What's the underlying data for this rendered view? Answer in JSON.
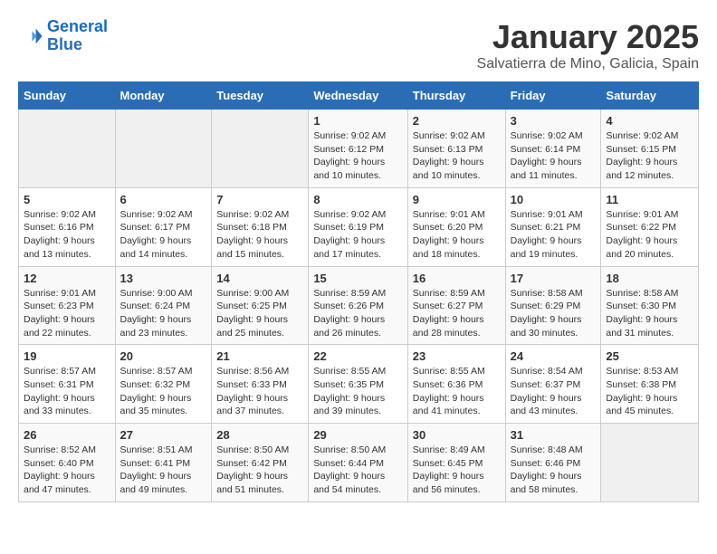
{
  "header": {
    "logo_line1": "General",
    "logo_line2": "Blue",
    "month": "January 2025",
    "location": "Salvatierra de Mino, Galicia, Spain"
  },
  "days_of_week": [
    "Sunday",
    "Monday",
    "Tuesday",
    "Wednesday",
    "Thursday",
    "Friday",
    "Saturday"
  ],
  "weeks": [
    [
      {
        "day": "",
        "content": ""
      },
      {
        "day": "",
        "content": ""
      },
      {
        "day": "",
        "content": ""
      },
      {
        "day": "1",
        "content": "Sunrise: 9:02 AM\nSunset: 6:12 PM\nDaylight: 9 hours and 10 minutes."
      },
      {
        "day": "2",
        "content": "Sunrise: 9:02 AM\nSunset: 6:13 PM\nDaylight: 9 hours and 10 minutes."
      },
      {
        "day": "3",
        "content": "Sunrise: 9:02 AM\nSunset: 6:14 PM\nDaylight: 9 hours and 11 minutes."
      },
      {
        "day": "4",
        "content": "Sunrise: 9:02 AM\nSunset: 6:15 PM\nDaylight: 9 hours and 12 minutes."
      }
    ],
    [
      {
        "day": "5",
        "content": "Sunrise: 9:02 AM\nSunset: 6:16 PM\nDaylight: 9 hours and 13 minutes."
      },
      {
        "day": "6",
        "content": "Sunrise: 9:02 AM\nSunset: 6:17 PM\nDaylight: 9 hours and 14 minutes."
      },
      {
        "day": "7",
        "content": "Sunrise: 9:02 AM\nSunset: 6:18 PM\nDaylight: 9 hours and 15 minutes."
      },
      {
        "day": "8",
        "content": "Sunrise: 9:02 AM\nSunset: 6:19 PM\nDaylight: 9 hours and 17 minutes."
      },
      {
        "day": "9",
        "content": "Sunrise: 9:01 AM\nSunset: 6:20 PM\nDaylight: 9 hours and 18 minutes."
      },
      {
        "day": "10",
        "content": "Sunrise: 9:01 AM\nSunset: 6:21 PM\nDaylight: 9 hours and 19 minutes."
      },
      {
        "day": "11",
        "content": "Sunrise: 9:01 AM\nSunset: 6:22 PM\nDaylight: 9 hours and 20 minutes."
      }
    ],
    [
      {
        "day": "12",
        "content": "Sunrise: 9:01 AM\nSunset: 6:23 PM\nDaylight: 9 hours and 22 minutes."
      },
      {
        "day": "13",
        "content": "Sunrise: 9:00 AM\nSunset: 6:24 PM\nDaylight: 9 hours and 23 minutes."
      },
      {
        "day": "14",
        "content": "Sunrise: 9:00 AM\nSunset: 6:25 PM\nDaylight: 9 hours and 25 minutes."
      },
      {
        "day": "15",
        "content": "Sunrise: 8:59 AM\nSunset: 6:26 PM\nDaylight: 9 hours and 26 minutes."
      },
      {
        "day": "16",
        "content": "Sunrise: 8:59 AM\nSunset: 6:27 PM\nDaylight: 9 hours and 28 minutes."
      },
      {
        "day": "17",
        "content": "Sunrise: 8:58 AM\nSunset: 6:29 PM\nDaylight: 9 hours and 30 minutes."
      },
      {
        "day": "18",
        "content": "Sunrise: 8:58 AM\nSunset: 6:30 PM\nDaylight: 9 hours and 31 minutes."
      }
    ],
    [
      {
        "day": "19",
        "content": "Sunrise: 8:57 AM\nSunset: 6:31 PM\nDaylight: 9 hours and 33 minutes."
      },
      {
        "day": "20",
        "content": "Sunrise: 8:57 AM\nSunset: 6:32 PM\nDaylight: 9 hours and 35 minutes."
      },
      {
        "day": "21",
        "content": "Sunrise: 8:56 AM\nSunset: 6:33 PM\nDaylight: 9 hours and 37 minutes."
      },
      {
        "day": "22",
        "content": "Sunrise: 8:55 AM\nSunset: 6:35 PM\nDaylight: 9 hours and 39 minutes."
      },
      {
        "day": "23",
        "content": "Sunrise: 8:55 AM\nSunset: 6:36 PM\nDaylight: 9 hours and 41 minutes."
      },
      {
        "day": "24",
        "content": "Sunrise: 8:54 AM\nSunset: 6:37 PM\nDaylight: 9 hours and 43 minutes."
      },
      {
        "day": "25",
        "content": "Sunrise: 8:53 AM\nSunset: 6:38 PM\nDaylight: 9 hours and 45 minutes."
      }
    ],
    [
      {
        "day": "26",
        "content": "Sunrise: 8:52 AM\nSunset: 6:40 PM\nDaylight: 9 hours and 47 minutes."
      },
      {
        "day": "27",
        "content": "Sunrise: 8:51 AM\nSunset: 6:41 PM\nDaylight: 9 hours and 49 minutes."
      },
      {
        "day": "28",
        "content": "Sunrise: 8:50 AM\nSunset: 6:42 PM\nDaylight: 9 hours and 51 minutes."
      },
      {
        "day": "29",
        "content": "Sunrise: 8:50 AM\nSunset: 6:44 PM\nDaylight: 9 hours and 54 minutes."
      },
      {
        "day": "30",
        "content": "Sunrise: 8:49 AM\nSunset: 6:45 PM\nDaylight: 9 hours and 56 minutes."
      },
      {
        "day": "31",
        "content": "Sunrise: 8:48 AM\nSunset: 6:46 PM\nDaylight: 9 hours and 58 minutes."
      },
      {
        "day": "",
        "content": ""
      }
    ]
  ]
}
